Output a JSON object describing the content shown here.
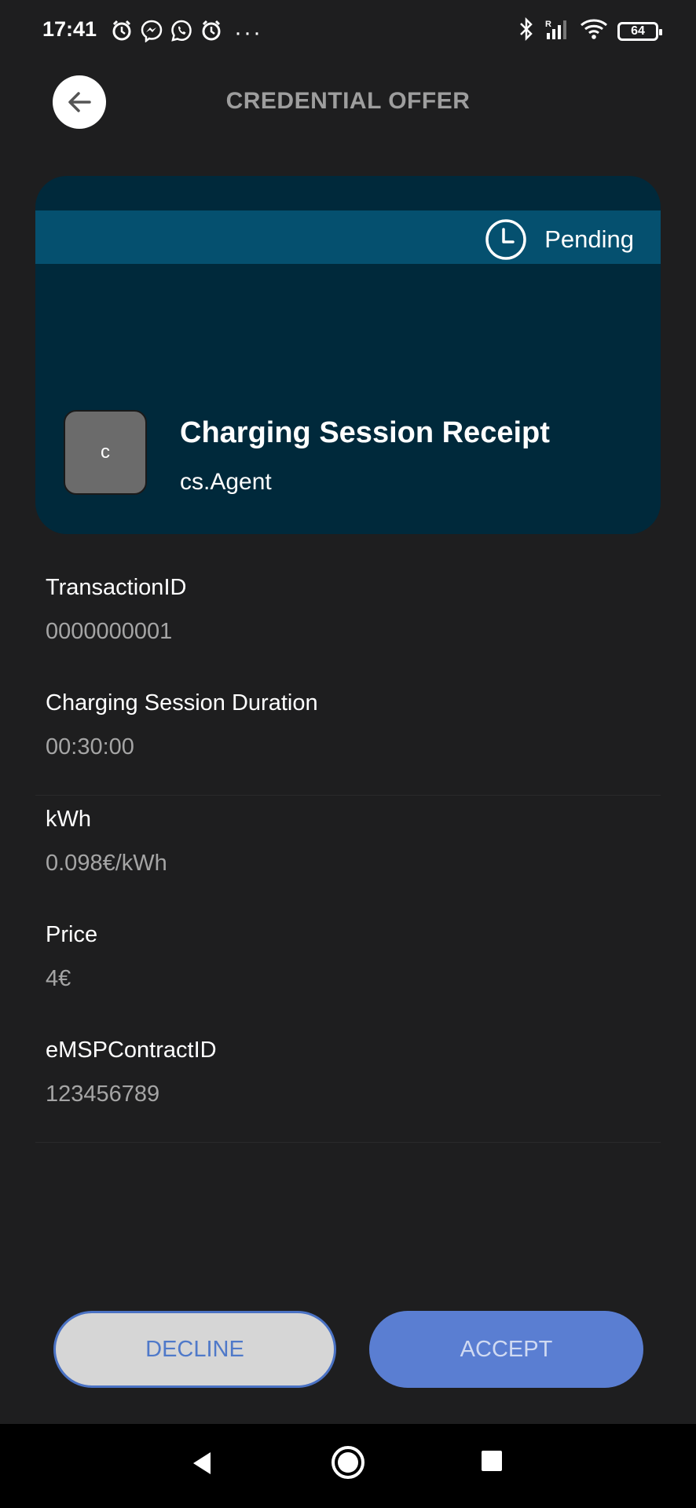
{
  "status_bar": {
    "time": "17:41",
    "left_icons": [
      "alarm-icon",
      "messenger-icon",
      "whatsapp-icon",
      "alarm-icon"
    ],
    "more": "···",
    "right_icons": [
      "bluetooth-icon",
      "signal-icon",
      "wifi-icon"
    ],
    "battery": "64"
  },
  "header": {
    "title": "CREDENTIAL OFFER",
    "back_icon": "arrow-left-icon"
  },
  "card": {
    "status": "Pending",
    "status_icon": "clock-icon",
    "logo_letter": "c",
    "title": "Charging Session Receipt",
    "issuer": "cs.Agent",
    "colors": {
      "background": "#00293b",
      "status_band": "#05506f"
    }
  },
  "attributes": [
    {
      "label": "TransactionID",
      "value": "0000000001"
    },
    {
      "label": "Charging Session Duration",
      "value": "00:30:00"
    },
    {
      "label": "kWh",
      "value": "0.098€/kWh"
    },
    {
      "label": "Price",
      "value": "4€"
    },
    {
      "label": "eMSPContractID",
      "value": "123456789"
    }
  ],
  "actions": {
    "decline": "DECLINE",
    "accept": "ACCEPT"
  },
  "nav": [
    "back-triangle-icon",
    "home-circle-icon",
    "recents-square-icon"
  ],
  "colors": {
    "accent": "#5a7ed2",
    "background": "#1e1e1f"
  }
}
